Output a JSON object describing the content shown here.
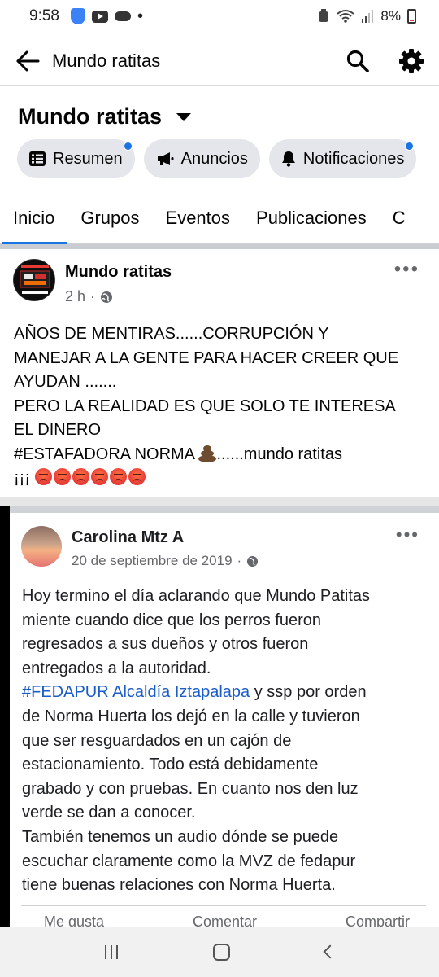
{
  "status_bar": {
    "time": "9:58",
    "battery": "8%",
    "icons": [
      "shield-icon",
      "youtube-icon",
      "cloud-icon",
      "dot-icon",
      "alarm-icon",
      "wifi-icon",
      "signal-icon",
      "battery-icon"
    ]
  },
  "header": {
    "title": "Mundo ratitas",
    "back_icon": "arrow-left-icon",
    "search_icon": "search-icon",
    "settings_icon": "gear-icon"
  },
  "page": {
    "name": "Mundo ratitas",
    "chips": [
      {
        "label": "Resumen",
        "icon": "list-icon",
        "has_dot": true
      },
      {
        "label": "Anuncios",
        "icon": "megaphone-icon",
        "has_dot": false
      },
      {
        "label": "Notificaciones",
        "icon": "bell-icon",
        "has_dot": true
      }
    ]
  },
  "tabs": [
    {
      "label": "Inicio",
      "active": true
    },
    {
      "label": "Grupos",
      "active": false
    },
    {
      "label": "Eventos",
      "active": false
    },
    {
      "label": "Publicaciones",
      "active": false
    },
    {
      "label": "C",
      "active": false
    }
  ],
  "post": {
    "author": "Mundo ratitas",
    "time": "2 h",
    "avatar_text": {
      "line1": "ASOCIACION",
      "line2": "Luchadores de Animales",
      "line3": "Mundo",
      "line4": "Ratitas",
      "line5": "MUNDO PATITAS A.C"
    },
    "lines": [
      "AÑOS DE MENTIRAS......CORRUPCIÓN  Y",
      "MANEJAR A LA GENTE  PARA HACER CREER QUE",
      "AYUDAN  .......",
      "PERO LA REALIDAD  ES QUE  SOLO TE INTERESA",
      "EL DINERO",
      "#ESTAFADORA  NORMA",
      "......mundo ratitas",
      "¡¡¡"
    ]
  },
  "shared_screenshot": {
    "author": "Carolina Mtz A",
    "date": "20 de septiembre de 2019",
    "lines": [
      "Hoy termino el día aclarando que Mundo Patitas",
      "miente cuando dice que los perros fueron",
      "regresados a sus dueños y otros fueron",
      "entregados a la autoridad.",
      "#FEDAPUR Alcaldía Iztapalapa",
      " y ssp por orden",
      "de Norma Huerta los dejó en la calle y tuvieron",
      "que ser resguardados en un cajón de",
      "estacionamiento. Todo está debidamente",
      "grabado y con pruebas. En cuanto nos den luz",
      "verde se dan a conocer.",
      "También tenemos un audio dónde se puede",
      "escuchar claramente como la MVZ de fedapur",
      "tiene buenas relaciones con Norma Huerta."
    ],
    "actions": [
      "Me gusta",
      "Comentar",
      "Compartir"
    ]
  },
  "colors": {
    "accent": "#1b74e4",
    "chip_bg": "#e4e6eb",
    "meta_text": "#65676b"
  }
}
